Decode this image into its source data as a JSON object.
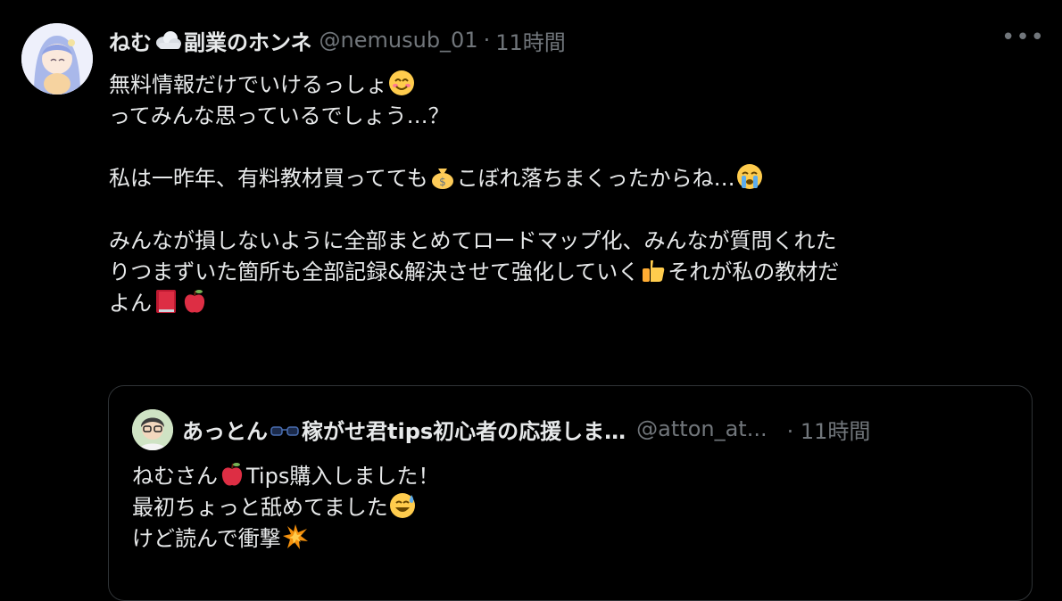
{
  "tweet": {
    "author_name": "ねむ",
    "author_name_suffix": "副業のホンネ",
    "author_handle": "@nemusub_01",
    "separator": "·",
    "time": "11時間",
    "more_label": "•••",
    "lines": {
      "l1": "無料情報だけでいけるっしょ",
      "l2": "ってみんな思っているでしょう…？",
      "l3a": "私は一昨年、有料教材買ってても",
      "l3b": "こぼれ落ちまくったからね…",
      "l4": "みんなが損しないように全部まとめてロードマップ化、みんなが質問くれた",
      "l5a": "りつまずいた箇所も全部記録&解決させて強化していく",
      "l5b": "それが私の教材だ",
      "l6": "よん"
    }
  },
  "quote": {
    "author_name_a": "あっとん",
    "author_name_b": "稼がせ君tips初心者の応援しま…",
    "author_handle": "@atton_at...",
    "time": "· 11時間",
    "lines": {
      "l1a": "ねむさん",
      "l1b": "Tips購入しました！",
      "l2": "最初ちょっと舐めてました",
      "l3": "けど読んで衝撃"
    }
  },
  "colors": {
    "background": "#000000",
    "text": "#e7e9ea",
    "muted": "#71767b",
    "border": "#2f3336"
  },
  "icons": [
    "cloud-icon",
    "smiling-face-icon",
    "money-bag-icon",
    "crying-face-icon",
    "thumbs-up-icon",
    "book-icon",
    "apple-icon",
    "glasses-icon",
    "sweat-smile-icon",
    "collision-icon",
    "more-icon"
  ]
}
